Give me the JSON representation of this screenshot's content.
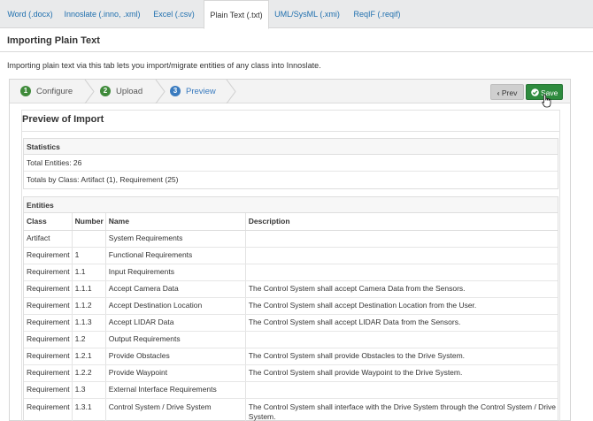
{
  "tabs": [
    {
      "label": "Word (.docx)"
    },
    {
      "label": "Innoslate (.inno, .xml)"
    },
    {
      "label": "Excel (.csv)"
    },
    {
      "label": "Plain Text (.txt)",
      "active": true
    },
    {
      "label": "UML/SysML (.xmi)"
    },
    {
      "label": "ReqIF (.reqif)"
    }
  ],
  "page": {
    "title": "Importing Plain Text",
    "intro": "Importing plain text via this tab lets you import/migrate entities of any class into Innoslate."
  },
  "wizard": {
    "steps": [
      {
        "number": "1",
        "label": "Configure",
        "color": "#3f8a3a"
      },
      {
        "number": "2",
        "label": "Upload",
        "color": "#3f8a3a"
      },
      {
        "number": "3",
        "label": "Preview",
        "color": "#3a7bbf"
      }
    ],
    "prev_label": "Prev",
    "save_label": "Save"
  },
  "preview": {
    "title": "Preview of Import",
    "statistics": {
      "heading": "Statistics",
      "total": "Total Entities: 26",
      "by_class": "Totals by Class: Artifact (1), Requirement (25)"
    },
    "entities": {
      "heading": "Entities",
      "columns": [
        "Class",
        "Number",
        "Name",
        "Description"
      ],
      "rows": [
        [
          "Artifact",
          "",
          "System Requirements",
          ""
        ],
        [
          "Requirement",
          "1",
          "Functional Requirements",
          ""
        ],
        [
          "Requirement",
          "1.1",
          "Input Requirements",
          ""
        ],
        [
          "Requirement",
          "1.1.1",
          "Accept Camera Data",
          "The Control System shall accept Camera Data from the Sensors."
        ],
        [
          "Requirement",
          "1.1.2",
          "Accept Destination Location",
          "The Control System shall accept Destination Location from the User."
        ],
        [
          "Requirement",
          "1.1.3",
          "Accept LIDAR Data",
          "The Control System shall accept LIDAR Data from the Sensors."
        ],
        [
          "Requirement",
          "1.2",
          "Output Requirements",
          ""
        ],
        [
          "Requirement",
          "1.2.1",
          "Provide Obstacles",
          "The Control System shall provide Obstacles to the Drive System."
        ],
        [
          "Requirement",
          "1.2.2",
          "Provide Waypoint",
          "The Control System shall provide Waypoint to the Drive System."
        ],
        [
          "Requirement",
          "1.3",
          "External Interface Requirements",
          ""
        ],
        [
          "Requirement",
          "1.3.1",
          "Control System / Drive System",
          "The Control System shall interface with the Drive System through the Control System / Drive System."
        ]
      ]
    }
  }
}
